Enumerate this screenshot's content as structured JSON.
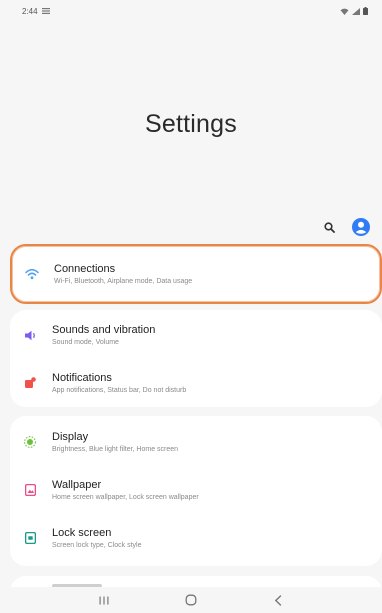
{
  "status": {
    "time": "2:44"
  },
  "header": {
    "title": "Settings"
  },
  "groups": [
    {
      "items": [
        {
          "title": "Connections",
          "subtitle": "Wi-Fi, Bluetooth, Airplane mode, Data usage",
          "icon": "wifi-icon",
          "color": "#4a9ff5"
        }
      ]
    },
    {
      "items": [
        {
          "title": "Sounds and vibration",
          "subtitle": "Sound mode, Volume",
          "icon": "volume-icon",
          "color": "#7c5cf0"
        },
        {
          "title": "Notifications",
          "subtitle": "App notifications, Status bar, Do not disturb",
          "icon": "notifications-icon",
          "color": "#f0524b"
        }
      ]
    },
    {
      "items": [
        {
          "title": "Display",
          "subtitle": "Brightness, Blue light filter, Home screen",
          "icon": "display-icon",
          "color": "#6ac23a"
        },
        {
          "title": "Wallpaper",
          "subtitle": "Home screen wallpaper, Lock screen wallpaper",
          "icon": "wallpaper-icon",
          "color": "#e84e8a"
        },
        {
          "title": "Lock screen",
          "subtitle": "Screen lock type, Clock style",
          "icon": "lock-screen-icon",
          "color": "#1a9c8a"
        }
      ]
    }
  ],
  "colors": {
    "accent": "#2f7cf6",
    "highlight": "#e98545"
  }
}
